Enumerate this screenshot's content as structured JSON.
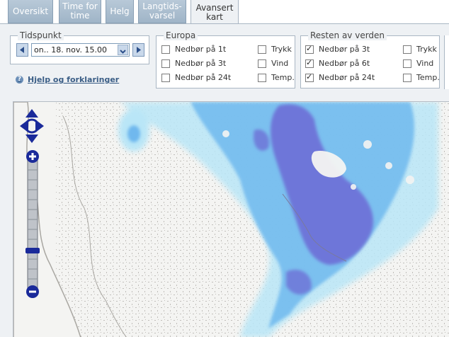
{
  "tabs": [
    {
      "label": "Oversikt",
      "active": false
    },
    {
      "label": "Time for time",
      "active": false
    },
    {
      "label": "Helg",
      "active": false
    },
    {
      "label": "Langtids-varsel",
      "active": false
    },
    {
      "label": "Avansert kart",
      "active": true
    }
  ],
  "tidspunkt": {
    "legend": "Tidspunkt",
    "selected": "on.. 18. nov. 15.00"
  },
  "europa": {
    "legend": "Europa",
    "options": [
      {
        "label": "Nedbør på 1t",
        "checked": false
      },
      {
        "label": "Nedbør på 3t",
        "checked": false
      },
      {
        "label": "Nedbør på 24t",
        "checked": false
      },
      {
        "label": "Trykk",
        "checked": false
      },
      {
        "label": "Vind",
        "checked": false
      },
      {
        "label": "Temp.",
        "checked": false
      }
    ]
  },
  "resten": {
    "legend": "Resten av verden",
    "options": [
      {
        "label": "Nedbør på 3t",
        "checked": true
      },
      {
        "label": "Nedbør på 6t",
        "checked": true
      },
      {
        "label": "Nedbør på 24t",
        "checked": true
      },
      {
        "label": "Trykk",
        "checked": false
      },
      {
        "label": "Vind",
        "checked": false
      },
      {
        "label": "Temp.",
        "checked": false
      }
    ]
  },
  "help": {
    "label": "Hjelp og forklaringer"
  },
  "colors": {
    "tab_bg": "#a9bccd",
    "precip_light": "#b9e6f7",
    "precip_mid": "#6fb8ee",
    "precip_heavy": "#6d6fd6",
    "land_water": "#a9a7a2",
    "map_bg": "#f4f4f2"
  }
}
